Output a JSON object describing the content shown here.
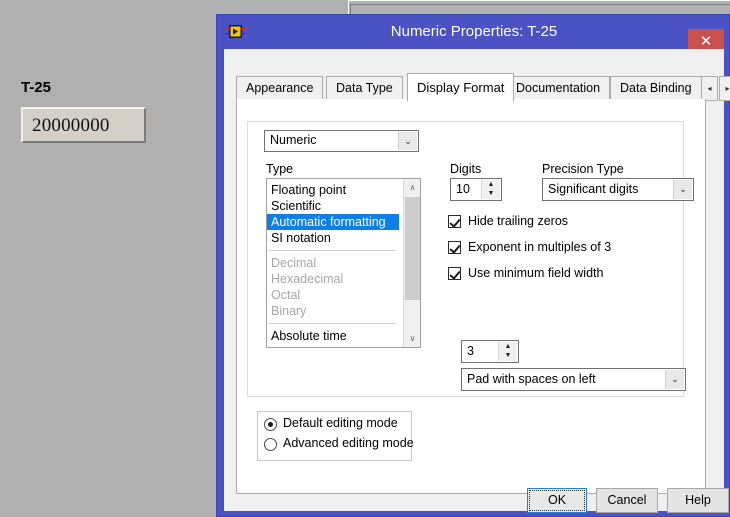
{
  "background_panel": {
    "control_label": "T-25",
    "control_value": "20000000"
  },
  "dialog": {
    "title": "Numeric Properties: T-25",
    "icon": "labview-vi-icon",
    "close_label": "✕",
    "titlebar_color": "#4b52c4",
    "close_color": "#c9504d"
  },
  "tabs": {
    "items": [
      {
        "label": "Appearance",
        "active": false
      },
      {
        "label": "Data Type",
        "active": false
      },
      {
        "label": "Display Format",
        "active": true
      },
      {
        "label": "Documentation",
        "active": false
      },
      {
        "label": "Data Binding",
        "active": false
      }
    ],
    "scroll_left": "◂",
    "scroll_right": "▸"
  },
  "display_format": {
    "format_select": {
      "value": "Numeric",
      "arrow": "⌄"
    },
    "type": {
      "label": "Type",
      "items": [
        {
          "label": "Floating point",
          "state": "normal"
        },
        {
          "label": "Scientific",
          "state": "normal"
        },
        {
          "label": "Automatic formatting",
          "state": "selected"
        },
        {
          "label": "SI notation",
          "state": "normal"
        },
        {
          "label": "Decimal",
          "state": "disabled"
        },
        {
          "label": "Hexadecimal",
          "state": "disabled"
        },
        {
          "label": "Octal",
          "state": "disabled"
        },
        {
          "label": "Binary",
          "state": "disabled"
        },
        {
          "label": "Absolute time",
          "state": "normal"
        }
      ],
      "selected": "Automatic formatting",
      "selection_color": "#0e7fe8",
      "scroll_up": "∧",
      "scroll_down": "∨"
    },
    "digits": {
      "label": "Digits",
      "value": "10",
      "up": "▲",
      "down": "▼"
    },
    "precision_type": {
      "label": "Precision Type",
      "value": "Significant digits",
      "arrow": "⌄"
    },
    "checkboxes": [
      {
        "label": "Hide trailing zeros",
        "checked": true
      },
      {
        "label": "Exponent in multiples of 3",
        "checked": true
      },
      {
        "label": "Use minimum field width",
        "checked": true
      }
    ],
    "field_width": {
      "value": "3",
      "up": "▲",
      "down": "▼"
    },
    "padding": {
      "value": "Pad with spaces on left",
      "arrow": "⌄"
    }
  },
  "editing_mode": {
    "options": [
      {
        "label": "Default editing mode",
        "selected": true
      },
      {
        "label": "Advanced editing mode",
        "selected": false
      }
    ]
  },
  "buttons": {
    "ok": "OK",
    "cancel": "Cancel",
    "help": "Help"
  }
}
